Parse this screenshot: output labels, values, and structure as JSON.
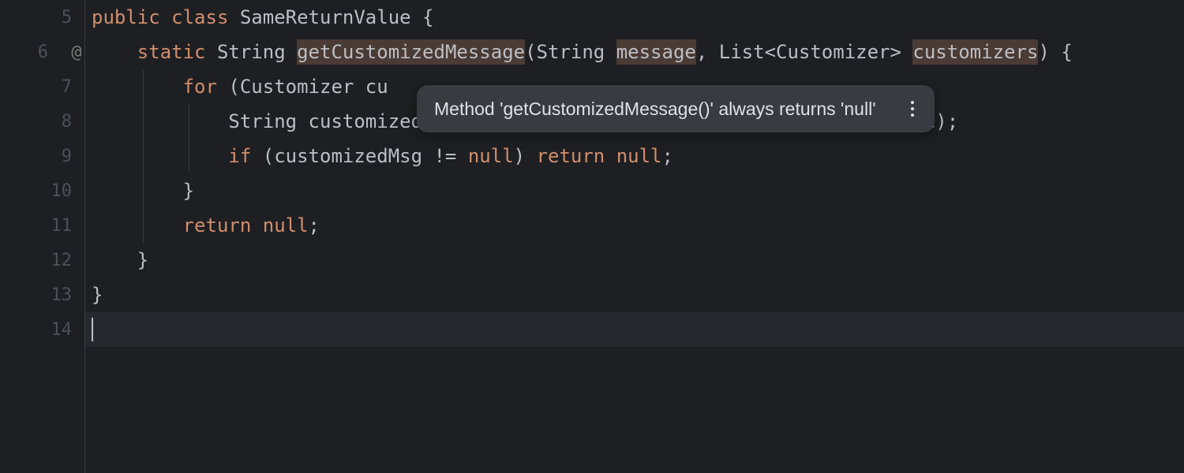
{
  "gutter": {
    "lines": [
      {
        "num": "5",
        "mark": ""
      },
      {
        "num": "6",
        "mark": "@"
      },
      {
        "num": "7",
        "mark": ""
      },
      {
        "num": "8",
        "mark": ""
      },
      {
        "num": "9",
        "mark": ""
      },
      {
        "num": "10",
        "mark": ""
      },
      {
        "num": "11",
        "mark": ""
      },
      {
        "num": "12",
        "mark": ""
      },
      {
        "num": "13",
        "mark": ""
      },
      {
        "num": "14",
        "mark": ""
      }
    ]
  },
  "code": {
    "l5": {
      "kw1": "public",
      "kw2": "class",
      "name": "SameReturnValue",
      "brace": " {"
    },
    "l6": {
      "indent": "    ",
      "kw1": "static",
      "type": "String",
      "method": "getCustomizedMessage",
      "lp": "(",
      "p1t": "String ",
      "p1n": "message",
      "c": ", ",
      "p2t": "List<Customizer> ",
      "p2n": "customizers",
      "rp": ")",
      "brace": " {"
    },
    "l7": {
      "indent": "        ",
      "kw": "for",
      "rest": " (Customizer cu"
    },
    "l8": {
      "indent": "            ",
      "type": "String",
      "rest1": " customizedMsg = customizer.getCustomizedMessage(message);"
    },
    "l9": {
      "indent": "            ",
      "kw1": "if",
      "lp": " (customizedMsg != ",
      "null1": "null",
      "rp": ") ",
      "kw2": "return",
      "sp": " ",
      "null2": "null",
      "semi": ";"
    },
    "l10": {
      "indent": "        ",
      "brace": "}"
    },
    "l11": {
      "indent": "        ",
      "kw": "return",
      "sp": " ",
      "null": "null",
      "semi": ";"
    },
    "l12": {
      "indent": "    ",
      "brace": "}"
    },
    "l13": {
      "brace": "}"
    }
  },
  "tooltip": {
    "text": "Method 'getCustomizedMessage()' always returns 'null'"
  }
}
